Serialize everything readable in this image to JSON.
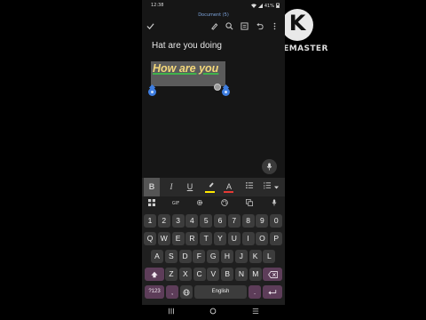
{
  "status_bar": {
    "time": "12:38",
    "battery": "41%"
  },
  "app_bar": {
    "document_title": "Document (5)",
    "icons": [
      "check-icon",
      "pen-icon",
      "search-icon",
      "read-mode-icon",
      "undo-icon",
      "more-icon"
    ]
  },
  "document": {
    "line1": "Hat are you doing",
    "wordart_text": "How are you"
  },
  "format_toolbar": {
    "bold": "B",
    "italic": "I",
    "underline": "U",
    "highlight_color": "#ffe800",
    "font_color_letter": "A",
    "font_color": "#e53935"
  },
  "keyboard": {
    "toolbar_gif": "GIF",
    "number_row": [
      "1",
      "2",
      "3",
      "4",
      "5",
      "6",
      "7",
      "8",
      "9",
      "0"
    ],
    "row1": [
      "Q",
      "W",
      "E",
      "R",
      "T",
      "Y",
      "U",
      "I",
      "O",
      "P"
    ],
    "row2": [
      "A",
      "S",
      "D",
      "F",
      "G",
      "H",
      "J",
      "K",
      "L"
    ],
    "row3": [
      "Z",
      "X",
      "C",
      "V",
      "B",
      "N",
      "M"
    ],
    "symbols_key": "?123",
    "comma_key": ",",
    "space_label": "English",
    "period_key": "."
  },
  "watermark": {
    "logo_letter": "K",
    "brand": "KINEMASTER"
  },
  "colors": {
    "accent_purple": "#5d3d59",
    "selection_blue": "#3d7de0",
    "wordart_yellow": "#f3d77a"
  }
}
